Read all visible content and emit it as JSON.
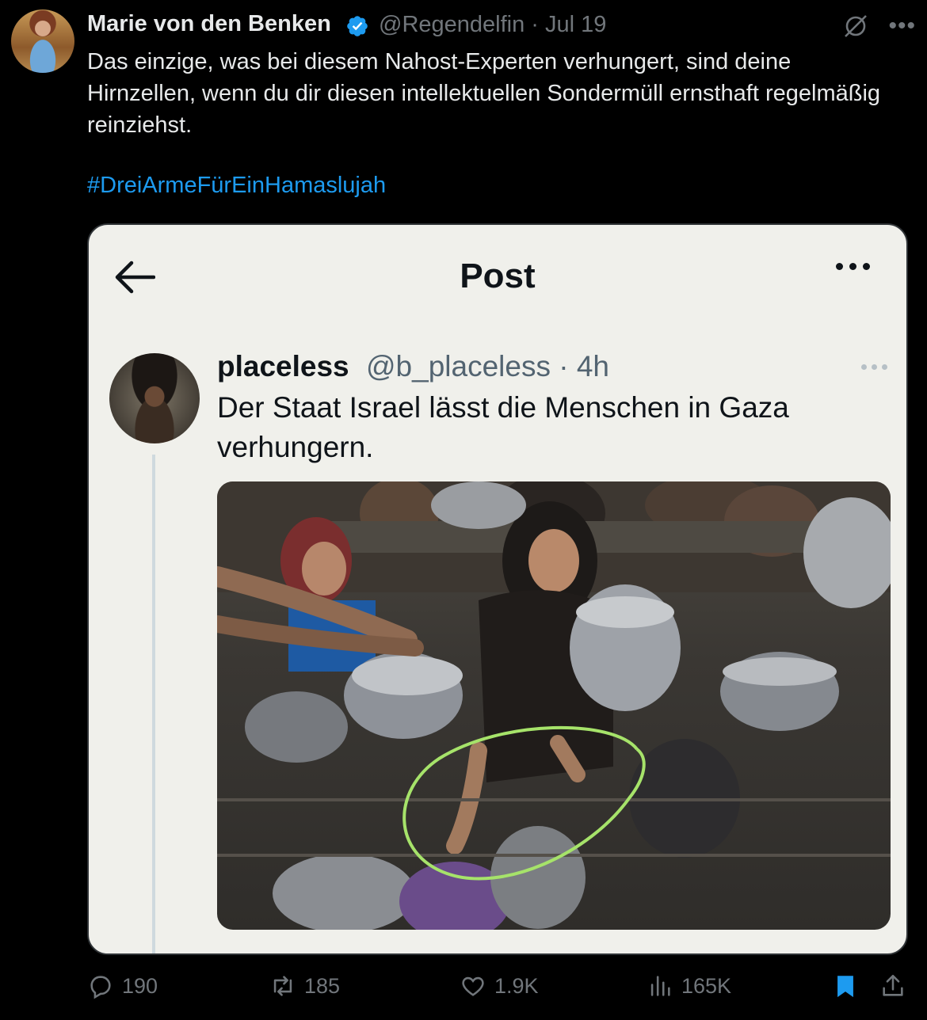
{
  "author": {
    "name": "Marie von den Benken",
    "handle": "@Regendelfin",
    "date": "· Jul 19",
    "verified": true
  },
  "tweet": {
    "text": "Das einzige, was bei diesem Nahost-Experten verhungert, sind deine Hirnzellen, wenn du dir diesen intellektuellen Sondermüll ernsthaft regelmäßig reinziehst.",
    "hashtag": "#DreiArmeFürEinHamaslujah"
  },
  "embedded": {
    "header_title": "Post",
    "author_name": "placeless",
    "author_handle": "@b_placeless",
    "time": "· 4h",
    "text": "Der Staat Israel lässt die Menschen in Gaza verhungern."
  },
  "actions": {
    "replies": "190",
    "reposts": "185",
    "likes": "1.9K",
    "views": "165K"
  },
  "colors": {
    "accent": "#1d9bf0",
    "muted": "#71767b",
    "highlight_circle": "#a6e36a"
  },
  "icons": [
    "verified-badge-icon",
    "grok-icon",
    "more-icon",
    "back-arrow-icon",
    "reply-icon",
    "repost-icon",
    "like-icon",
    "views-icon",
    "bookmark-icon",
    "share-icon"
  ]
}
